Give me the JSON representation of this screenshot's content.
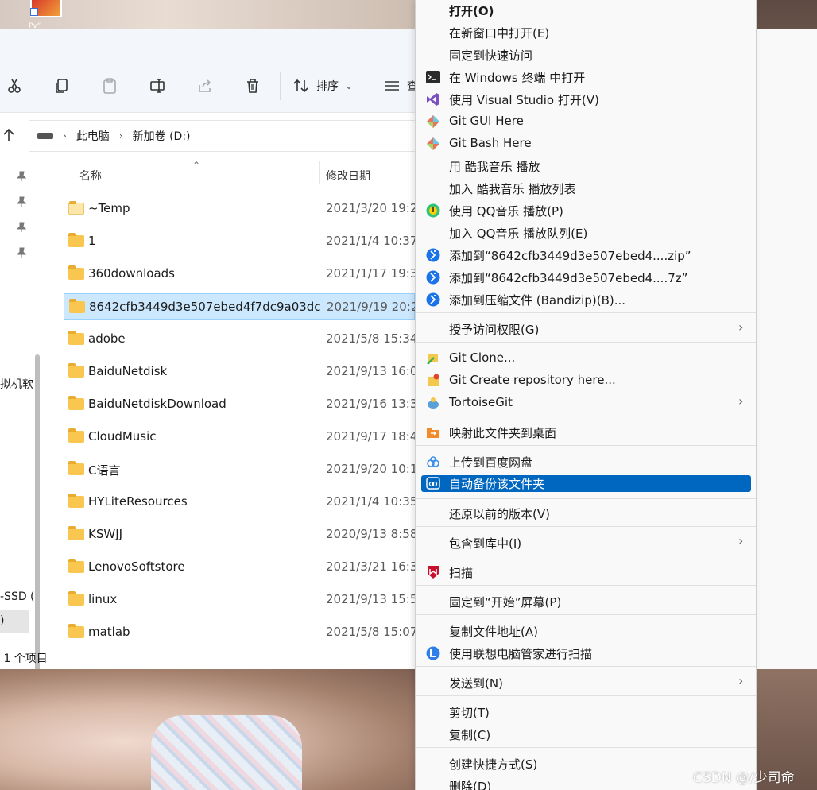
{
  "desktop": {
    "icon_label": "Pv“"
  },
  "explorer": {
    "toolbar": {
      "sort_label": "排序",
      "view_label": "查"
    },
    "address": {
      "crumb1": "此电脑",
      "crumb2": "新加卷 (D:)"
    },
    "nav": {
      "item1": "拟机软",
      "item2": "-SSD (",
      "item3": ")"
    },
    "columns": {
      "name": "名称",
      "date": "修改日期"
    },
    "files": [
      {
        "name": "~Temp",
        "date": "2021/3/20 19:2"
      },
      {
        "name": "1",
        "date": "2021/1/4 10:37"
      },
      {
        "name": "360downloads",
        "date": "2021/1/17 19:3"
      },
      {
        "name": "8642cfb3449d3e507ebed4f7dc9a03dc",
        "date": "2021/9/19 20:2"
      },
      {
        "name": "adobe",
        "date": "2021/5/8 15:34"
      },
      {
        "name": "BaiduNetdisk",
        "date": "2021/9/13 16:0"
      },
      {
        "name": "BaiduNetdiskDownload",
        "date": "2021/9/16 13:3"
      },
      {
        "name": "CloudMusic",
        "date": "2021/9/17 18:4"
      },
      {
        "name": "C语言",
        "date": "2021/9/20 10:1"
      },
      {
        "name": "HYLiteResources",
        "date": "2021/1/4 10:35"
      },
      {
        "name": "KSWJJ",
        "date": "2020/9/13 8:58"
      },
      {
        "name": "LenovoSoftstore",
        "date": "2021/3/21 16:3"
      },
      {
        "name": "linux",
        "date": "2021/9/13 15:5"
      },
      {
        "name": "matlab",
        "date": "2021/5/8 15:07"
      }
    ],
    "status": "1 个项目"
  },
  "menu": {
    "open": "打开(O)",
    "open_new_window": "在新窗口中打开(E)",
    "pin_quick_access": "固定到快速访问",
    "open_terminal": "在 Windows 终端 中打开",
    "open_vs": "使用 Visual Studio 打开(V)",
    "git_gui": "Git GUI Here",
    "git_bash": "Git Bash Here",
    "kuwo_play": "用 酷我音乐 播放",
    "kuwo_add": "加入 酷我音乐 播放列表",
    "qq_play": "使用 QQ音乐 播放(P)",
    "qq_add": "加入 QQ音乐 播放队列(E)",
    "zip": "添加到“8642cfb3449d3e507ebed4....zip”",
    "sevenz": "添加到“8642cfb3449d3e507ebed4....7z”",
    "bandizip": "添加到压缩文件 (Bandizip)(B)...",
    "grant_access": "授予访问权限(G)",
    "git_clone": "Git Clone...",
    "git_create": "Git Create repository here...",
    "tortoise": "TortoiseGit",
    "map_desktop": "映射此文件夹到桌面",
    "baidu_upload": "上传到百度网盘",
    "auto_backup": "自动备份该文件夹",
    "restore": "还原以前的版本(V)",
    "include_library": "包含到库中(I)",
    "scan": "扫描",
    "pin_start": "固定到“开始”屏幕(P)",
    "copy_path": "复制文件地址(A)",
    "lenovo_scan": "使用联想电脑管家进行扫描",
    "send_to": "发送到(N)",
    "cut": "剪切(T)",
    "copy": "复制(C)",
    "create_shortcut": "创建快捷方式(S)",
    "delete": "删除(D)"
  },
  "watermark": "CSDN @/少司命",
  "colors": {
    "highlight": "#0067c0",
    "selection": "#cce8ff",
    "folder": "#f9c74f"
  }
}
